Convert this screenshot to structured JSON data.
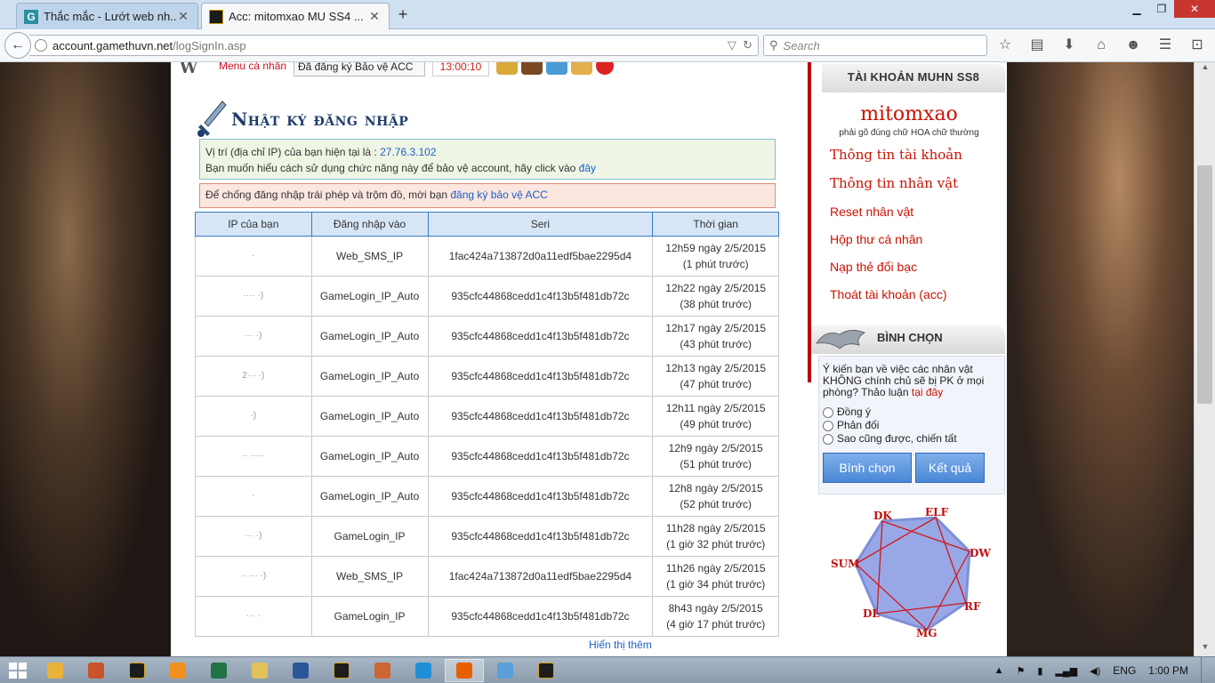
{
  "browser": {
    "tabs": [
      {
        "title": "Thắc mắc - Lướt web nh...",
        "favicon": "g-letter-icon",
        "active": false
      },
      {
        "title": "Acc: mitomxao MU SS4 ...",
        "favicon": "mu-game-icon",
        "active": true
      }
    ],
    "url_host": "account.gamethuvn.net",
    "url_path": "/logSignIn.asp",
    "search_placeholder": "Search",
    "window_buttons": [
      "minimize",
      "restore",
      "close"
    ]
  },
  "topbar": {
    "logo": "W",
    "menu_label": "Menu cá nhân",
    "protect_select": "Đã đăng ký Bảo vệ ACC",
    "clock": "13:00:10"
  },
  "page": {
    "title": "Nhật ký đăng nhập",
    "info_line1_prefix": "Vị trí (địa chỉ IP) của bạn hiện tại là : ",
    "info_ip": "27.76.3.102",
    "info_line2_prefix": "Bạn muốn hiểu cách sử dụng chức năng này để bảo vệ account, hãy click vào ",
    "info_line2_link": "đây",
    "warn_prefix": "Để chống đăng nhập trái phép và trộm đồ, mời bạn ",
    "warn_link": "đăng ký bảo vệ ACC",
    "show_more": "Hiển thị thêm"
  },
  "table": {
    "headers": [
      "IP của bạn",
      "Đăng nhập vào",
      "Seri",
      "Thời gian"
    ],
    "rows": [
      {
        "ip": "·",
        "login": "Web_SMS_IP",
        "seri": "1fac424a713872d0a11edf5bae2295d4",
        "time": "12h59 ngày 2/5/2015",
        "ago": "(1 phút trước)"
      },
      {
        "ip": "···· ·)",
        "login": "GameLogin_IP_Auto",
        "seri": "935cfc44868cedd1c4f13b5f481db72c",
        "time": "12h22 ngày 2/5/2015",
        "ago": "(38 phút trước)"
      },
      {
        "ip": "··· ·)",
        "login": "GameLogin_IP_Auto",
        "seri": "935cfc44868cedd1c4f13b5f481db72c",
        "time": "12h17 ngày 2/5/2015",
        "ago": "(43 phút trước)"
      },
      {
        "ip": "2··· ·)",
        "login": "GameLogin_IP_Auto",
        "seri": "935cfc44868cedd1c4f13b5f481db72c",
        "time": "12h13 ngày 2/5/2015",
        "ago": "(47 phút trước)"
      },
      {
        "ip": "·)",
        "login": "GameLogin_IP_Auto",
        "seri": "935cfc44868cedd1c4f13b5f481db72c",
        "time": "12h11 ngày 2/5/2015",
        "ago": "(49 phút trước)"
      },
      {
        "ip": "·· ·····",
        "login": "GameLogin_IP_Auto",
        "seri": "935cfc44868cedd1c4f13b5f481db72c",
        "time": "12h9 ngày 2/5/2015",
        "ago": "(51 phút trước)"
      },
      {
        "ip": "·",
        "login": "GameLogin_IP_Auto",
        "seri": "935cfc44868cedd1c4f13b5f481db72c",
        "time": "12h8 ngày 2/5/2015",
        "ago": "(52 phút trước)"
      },
      {
        "ip": "··· ·)",
        "login": "GameLogin_IP",
        "seri": "935cfc44868cedd1c4f13b5f481db72c",
        "time": "11h28 ngày 2/5/2015",
        "ago": "(1 giờ 32 phút trước)"
      },
      {
        "ip": "·· ··· ·)",
        "login": "Web_SMS_IP",
        "seri": "1fac424a713872d0a11edf5bae2295d4",
        "time": "11h26 ngày 2/5/2015",
        "ago": "(1 giờ 34 phút trước)"
      },
      {
        "ip": "··· ·",
        "login": "GameLogin_IP",
        "seri": "935cfc44868cedd1c4f13b5f481db72c",
        "time": "8h43 ngày 2/5/2015",
        "ago": "(4 giờ 17 phút trước)"
      }
    ]
  },
  "sidebar": {
    "header": "TÀI KHOẢN MUHN SS8",
    "username": "mitomxao",
    "case_hint": "phải gõ đúng chữ HOA chữ thường",
    "menu": [
      {
        "label": "Thông tin tài khoản",
        "style": "big"
      },
      {
        "label": "Thông tin nhân vật",
        "style": "big"
      },
      {
        "label": "Reset nhân vật",
        "style": "small"
      },
      {
        "label": "Hộp thư cá nhân",
        "style": "small"
      },
      {
        "label": "Nạp thẻ đổi bạc",
        "style": "small"
      },
      {
        "label": "Thoát tài khoản (acc)",
        "style": "small"
      }
    ],
    "vote": {
      "title": "BÌNH CHỌN",
      "question": "Ý kiến bạn về việc các nhân vật KHÔNG chính chủ sẽ bị PK ở mọi phòng? Thảo luận ",
      "question_link": "tại đây",
      "options": [
        "Đồng ý",
        "Phản đối",
        "Sao cũng được, chiến tất"
      ],
      "vote_button": "Bình chọn",
      "result_button": "Kết quả"
    },
    "class_labels": [
      "DK",
      "ELF",
      "DW",
      "RF",
      "MG",
      "DL",
      "SUM"
    ]
  },
  "taskbar": {
    "apps": [
      "windows-start",
      "chrome",
      "powerpoint-viewer",
      "mu-game",
      "media-player",
      "excel",
      "file-explorer",
      "word",
      "mu-game",
      "tool",
      "internet-explorer",
      "firefox",
      "paint",
      "mu-game"
    ],
    "language": "ENG",
    "time": "1:00 PM"
  },
  "colors": {
    "title_blue": "#1e3d6b",
    "link_blue": "#1a5fc7",
    "menu_red": "#cc1100",
    "table_border": "#3a7ac3",
    "header_bg": "#d7e6f7"
  }
}
